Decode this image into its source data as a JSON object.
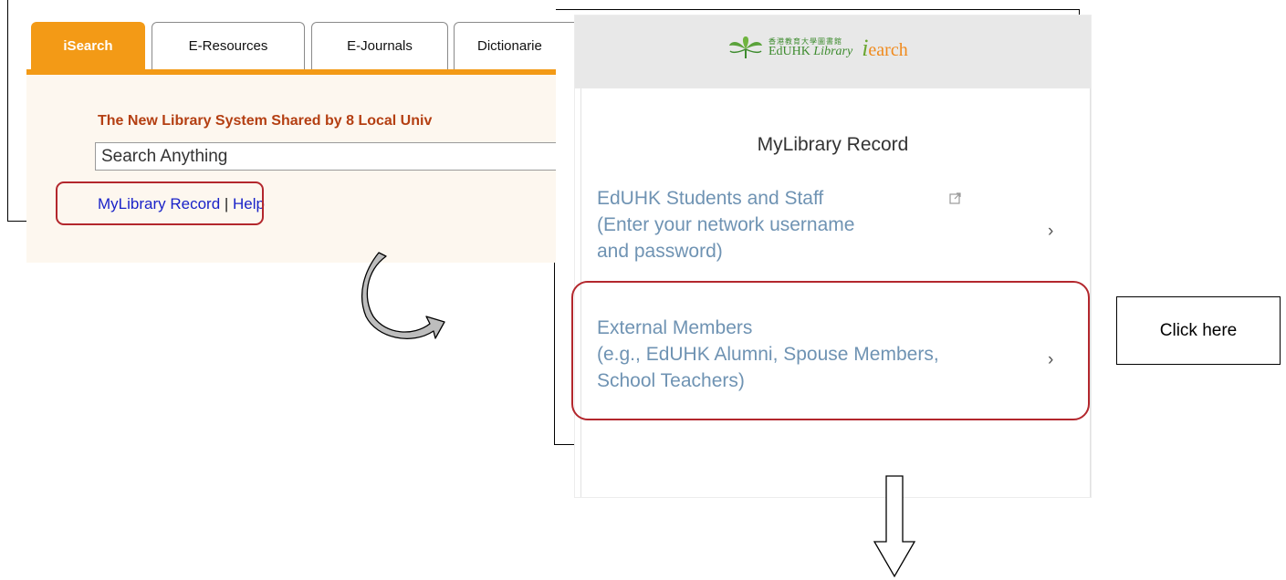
{
  "library_home": {
    "tabs": [
      "iSearch",
      "E-Resources",
      "E-Journals",
      "Dictionarie"
    ],
    "heading": "The New Library System Shared by 8 Local Univ",
    "search_placeholder": "Search Anything",
    "link_record": "MyLibrary Record",
    "link_separator": " | ",
    "link_help": "Help"
  },
  "login_panel": {
    "logo": {
      "cjk": "香港教育大學圖書館",
      "edu": "EdUHK",
      "library": "Library",
      "isearch_i": "i",
      "isearch_rest": "earch"
    },
    "title": "MyLibrary Record",
    "options": [
      {
        "lines": [
          "EdUHK Students and Staff",
          "(Enter your network username",
          "and password)"
        ]
      },
      {
        "lines": [
          "External Members",
          "(e.g., EdUHK Alumni, Spouse Members,",
          "School Teachers)"
        ]
      }
    ]
  },
  "annotation": {
    "click_here": "Click here"
  },
  "colors": {
    "tab_accent": "#f39a16",
    "heading": "#b43f12",
    "link": "#1a23c8",
    "highlight_border": "#b3272d",
    "option_text": "#6f93b3"
  }
}
